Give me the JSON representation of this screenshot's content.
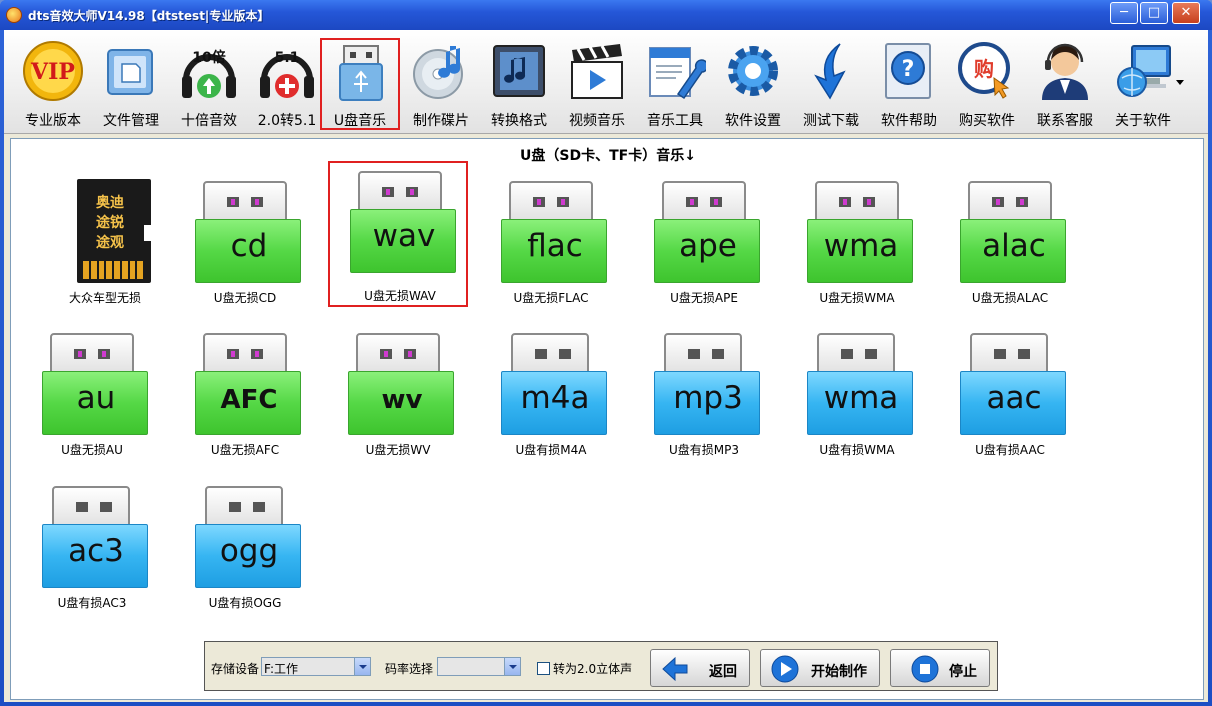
{
  "window": {
    "title": "dts音效大师V14.98【dtstest|专业版本】",
    "min_label": "─",
    "max_label": "□",
    "close_label": "✕"
  },
  "toolbar": {
    "items": [
      {
        "label": "专业版本",
        "icon": "vip-medal-icon"
      },
      {
        "label": "文件管理",
        "icon": "folder-icon"
      },
      {
        "label": "十倍音效",
        "icon": "headphones-10x-icon"
      },
      {
        "label": "2.0转5.1",
        "icon": "headphones-51-icon"
      },
      {
        "label": "U盘音乐",
        "icon": "usb-drive-icon",
        "selected": true
      },
      {
        "label": "制作碟片",
        "icon": "disc-icon"
      },
      {
        "label": "转换格式",
        "icon": "music-note-icon"
      },
      {
        "label": "视频音乐",
        "icon": "clapperboard-icon"
      },
      {
        "label": "音乐工具",
        "icon": "tools-icon"
      },
      {
        "label": "软件设置",
        "icon": "gear-icon"
      },
      {
        "label": "测试下载",
        "icon": "download-arrow-icon"
      },
      {
        "label": "软件帮助",
        "icon": "help-icon"
      },
      {
        "label": "购买软件",
        "icon": "shop-icon"
      },
      {
        "label": "联系客服",
        "icon": "support-agent-icon"
      },
      {
        "label": "关于软件",
        "icon": "about-globe-icon"
      }
    ],
    "vip_text": "VIP",
    "tenx_text": "10倍",
    "fiveone_text": "5.1",
    "buy_text": "购"
  },
  "content": {
    "section_title": "U盘（SD卡、TF卡）音乐↓",
    "sd_card_text": [
      "奥迪",
      "途锐",
      "途观"
    ],
    "tiles": [
      {
        "format": "",
        "name": "大众车型无损",
        "kind": "sdcard"
      },
      {
        "format": "cd",
        "name": "U盘无损CD",
        "kind": "green"
      },
      {
        "format": "wav",
        "name": "U盘无损WAV",
        "kind": "green",
        "selected": true
      },
      {
        "format": "flac",
        "name": "U盘无损FLAC",
        "kind": "green"
      },
      {
        "format": "ape",
        "name": "U盘无损APE",
        "kind": "green"
      },
      {
        "format": "wma",
        "name": "U盘无损WMA",
        "kind": "green"
      },
      {
        "format": "alac",
        "name": "U盘无损ALAC",
        "kind": "green"
      },
      {
        "format": "au",
        "name": "U盘无损AU",
        "kind": "green"
      },
      {
        "format": "AFC",
        "name": "U盘无损AFC",
        "kind": "green"
      },
      {
        "format": "wv",
        "name": "U盘无损WV",
        "kind": "green"
      },
      {
        "format": "m4a",
        "name": "U盘有损M4A",
        "kind": "blue"
      },
      {
        "format": "mp3",
        "name": "U盘有损MP3",
        "kind": "blue"
      },
      {
        "format": "wma",
        "name": "U盘有损WMA",
        "kind": "blue"
      },
      {
        "format": "aac",
        "name": "U盘有损AAC",
        "kind": "blue"
      },
      {
        "format": "ac3",
        "name": "U盘有损AC3",
        "kind": "blue"
      },
      {
        "format": "ogg",
        "name": "U盘有损OGG",
        "kind": "blue"
      }
    ]
  },
  "bottom": {
    "storage_label": "存储设备",
    "storage_value": "F:工作",
    "bitrate_label": "码率选择",
    "bitrate_value": "",
    "stereo_label": "转为2.0立体声",
    "stereo_checked": false,
    "back_label": "返回",
    "start_label": "开始制作",
    "stop_label": "停止"
  },
  "colors": {
    "title_blue": "#2557d8",
    "lossless_green": "#55d846",
    "lossy_blue": "#36b5f2",
    "selection_red": "#e02020"
  }
}
